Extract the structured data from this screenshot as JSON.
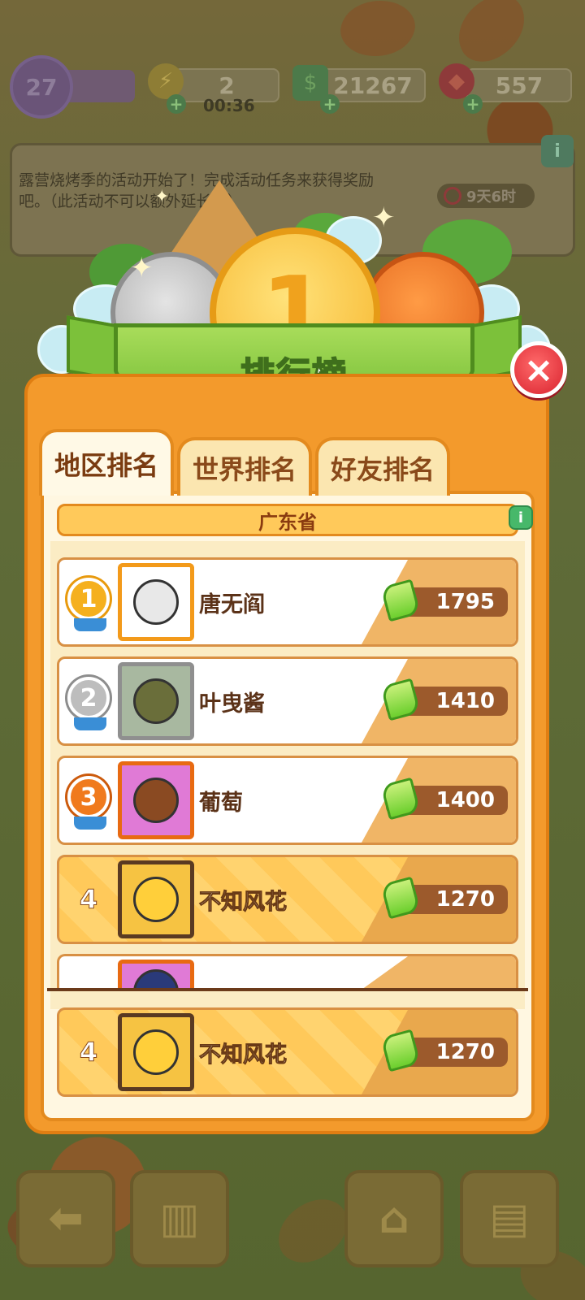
{
  "hud": {
    "level": "27",
    "energy": "2",
    "energy_timer": "00:36",
    "cash": "21267",
    "gems": "557"
  },
  "notice": {
    "text": "露营烧烤季的活动开始了！完成活动任务来获得奖励吧。（此活动不可以额外延长哦）",
    "time_left": "9天6时"
  },
  "banner": {
    "title": "排行榜"
  },
  "tabs": [
    {
      "label": "地区排名",
      "active": true
    },
    {
      "label": "世界排名",
      "active": false
    },
    {
      "label": "好友排名",
      "active": false
    }
  ],
  "region": "广东省",
  "rows": [
    {
      "rank": "1",
      "name": "唐无阎",
      "score": "1795"
    },
    {
      "rank": "2",
      "name": "叶曳酱",
      "score": "1410"
    },
    {
      "rank": "3",
      "name": "葡萄",
      "score": "1400"
    },
    {
      "rank": "4",
      "name": "不知风花",
      "score": "1270"
    }
  ],
  "self_row": {
    "rank": "4",
    "name": "不知风花",
    "score": "1270"
  },
  "icons": {
    "close": "×",
    "info": "i",
    "bolt": "⚡",
    "plus": "+",
    "back": "⬅",
    "podium": "▥",
    "basket": "🧺",
    "clipboard": "📋",
    "gold_number": "1"
  },
  "colors": {
    "panel": "#f39a2c",
    "banner_green": "#7cc13a",
    "close_red": "#d9232f",
    "score_pill": "#9c5a2c"
  }
}
